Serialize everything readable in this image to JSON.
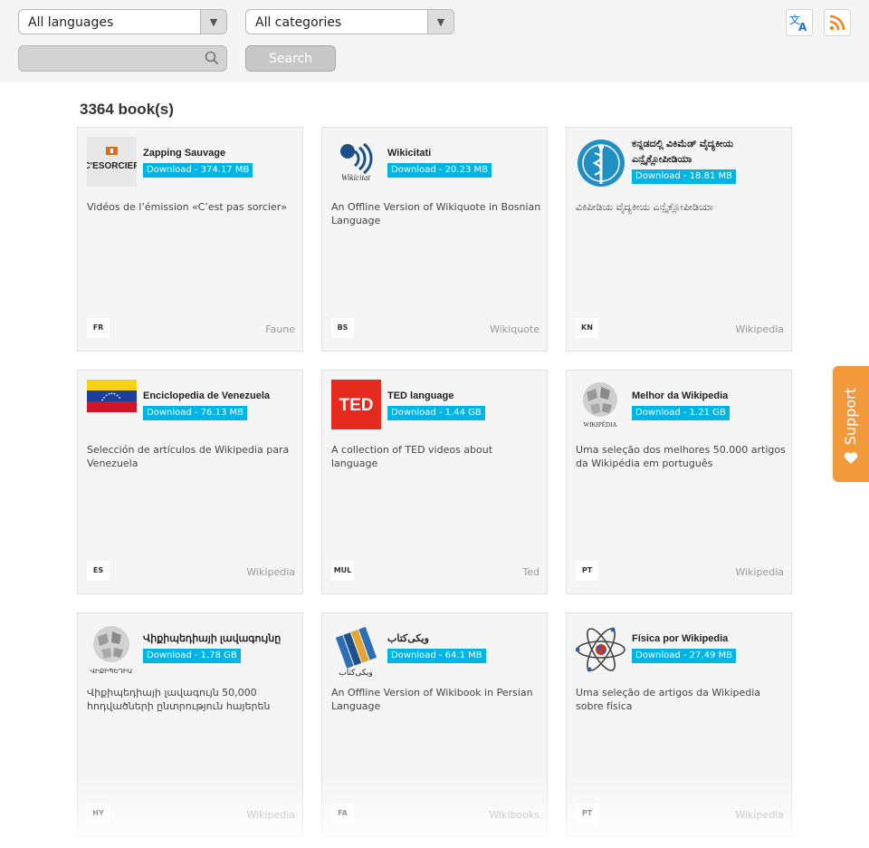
{
  "filters": {
    "language": "All languages",
    "category": "All categories",
    "search_placeholder": "",
    "search_label": "Search"
  },
  "count_text": "3364 book(s)",
  "support_label": "Support",
  "colors": {
    "download_badge": "#00b4e6",
    "support": "#f29a3b",
    "rss": "#f58220",
    "translate": "#1a73e8"
  },
  "cards": [
    {
      "title": "Zapping Sauvage",
      "download": "Download - 374.17 MB",
      "description": "Vidéos de l’émission «C’est pas sorcier»",
      "lang": "FR",
      "category": "Faune",
      "thumb_text": "C'ESORCIER"
    },
    {
      "title": "Wikicitati",
      "download": "Download - 20.23 MB",
      "description": "An Offline Version of Wikiquote in Bosnian Language",
      "lang": "BS",
      "category": "Wikiquote",
      "thumb_text": "Wikicitat"
    },
    {
      "title": "ಕನ್ನಡದಲ್ಲಿ ವಿಕಿಮೆಡ್ ವೈದ್ಯಕೀಯ ಎನ್ಸೈಕ್ಲೋಪೀಡಿಯಾ",
      "download": "Download - 18.81 MB",
      "description": "ವಿಕಿಪೀಡಿಯ ವೈದ್ಯಕೀಯ ಎನ್ಸೈಕ್ಲೋಪೀಡಿಯಾ",
      "lang": "KN",
      "category": "Wikipedia"
    },
    {
      "title": "Enciclopedia de Venezuela",
      "download": "Download - 76.13 MB",
      "description": "Selección de artículos de Wikipedia para Venezuela",
      "lang": "ES",
      "category": "Wikipedia"
    },
    {
      "title": "TED language",
      "download": "Download - 1.44 GB",
      "description": "A collection of TED videos about language",
      "lang": "MUL",
      "category": "Ted",
      "thumb_text": "TED"
    },
    {
      "title": "Melhor da Wikipedia",
      "download": "Download - 1.21 GB",
      "description": "Uma seleção dos melhores 50.000 artigos da Wikipédia em português",
      "lang": "PT",
      "category": "Wikipedia",
      "thumb_text": "WIKIPÉDIA"
    },
    {
      "title": "Վիքիպեդիայի լավագույնը",
      "download": "Download - 1.78 GB",
      "description": "Վիքիպեդիայի լավագույն 50,000 հոդվածների ընտրություն հայերեն",
      "lang": "HY",
      "category": "Wikipedia",
      "thumb_text": "ՎԻՔԻՊԵԴԻԱ"
    },
    {
      "title": "ویکی‌کتاب",
      "download": "Download - 64.1 MB",
      "description": "An Offline Version of Wikibook in Persian Language",
      "lang": "FA",
      "category": "Wikibooks",
      "thumb_text": "ویکی‌کتاب"
    },
    {
      "title": "Física por Wikipedia",
      "download": "Download - 27.49 MB",
      "description": "Uma seleção de artigos da Wikipedia sobre física",
      "lang": "PT",
      "category": "Wikipedia"
    }
  ]
}
